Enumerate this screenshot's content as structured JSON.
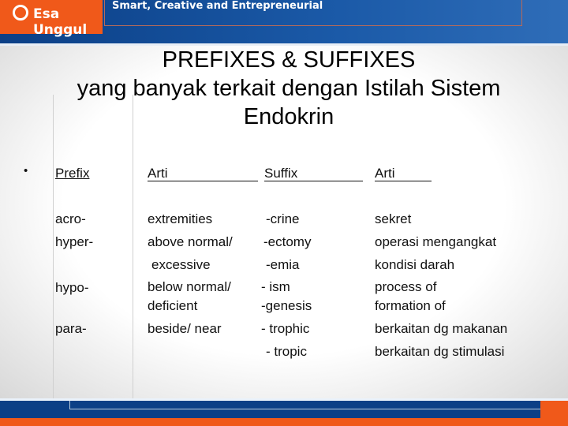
{
  "header": {
    "logo": "Esa Unggul",
    "tagline": "Smart, Creative and Entrepreneurial"
  },
  "title": [
    "PREFIXES & SUFFIXES",
    "yang banyak terkait dengan Istilah Sistem",
    "Endokrin"
  ],
  "table": {
    "headers": [
      "Prefix",
      "Arti",
      "Suffix",
      "Arti"
    ],
    "prefixes": [
      {
        "prefix": "acro-",
        "arti": "extremities"
      },
      {
        "prefix": "hyper-",
        "arti": "above normal/",
        "arti2": "excessive"
      },
      {
        "prefix": "hypo-",
        "arti": "below normal/",
        "arti2": "deficient"
      },
      {
        "prefix": "para-",
        "arti": "beside/ near"
      }
    ],
    "suffixes": [
      {
        "suffix": "-crine",
        "arti": "sekret"
      },
      {
        "suffix": "-ectomy",
        "arti": "operasi mengangkat"
      },
      {
        "suffix": "-emia",
        "arti": "kondisi  darah"
      },
      {
        "suffix": "- ism",
        "arti": "process of"
      },
      {
        "suffix": "-genesis",
        "arti": "formation of"
      },
      {
        "suffix": "- trophic",
        "arti": "berkaitan dg makanan"
      },
      {
        "suffix": "- tropic",
        "arti": "berkaitan dg stimulasi"
      }
    ]
  },
  "colors": {
    "blue": "#0b3f86",
    "orange": "#f0591a"
  }
}
